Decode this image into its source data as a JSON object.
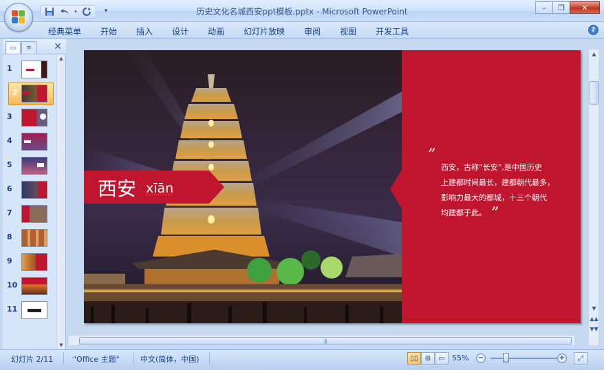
{
  "window": {
    "title": "历史文化名城西安ppt模板.pptx - Microsoft PowerPoint",
    "minimize_label": "–",
    "restore_label": "❐",
    "close_label": "✕"
  },
  "qat": {
    "save_icon": "save-icon",
    "undo_icon": "undo-icon",
    "redo_icon": "redo-icon",
    "customize_icon": "dropdown-arrow-icon"
  },
  "ribbon": {
    "tabs": [
      "经典菜单",
      "开始",
      "插入",
      "设计",
      "动画",
      "幻灯片放映",
      "审阅",
      "视图",
      "开发工具"
    ],
    "help_label": "?"
  },
  "left_panel": {
    "close_label": "✕",
    "slides": [
      {
        "num": "1"
      },
      {
        "num": "2"
      },
      {
        "num": "3"
      },
      {
        "num": "4"
      },
      {
        "num": "5"
      },
      {
        "num": "6"
      },
      {
        "num": "7"
      },
      {
        "num": "8"
      },
      {
        "num": "9"
      },
      {
        "num": "10"
      },
      {
        "num": "11"
      }
    ],
    "selected_index": 1
  },
  "slide": {
    "title_cn": "西安",
    "title_pinyin": "xīān",
    "open_quote": "”",
    "close_quote": "”",
    "description_lines": [
      "西安，古称“长安”,是中国历史",
      "上建都时间最长，建都朝代最多，",
      "影响力最大的都城，十三个朝代",
      "均建都于此。"
    ],
    "accent_color": "#c0152f"
  },
  "statusbar": {
    "slide_position": "幻灯片 2/11",
    "theme": "\"Office 主题\"",
    "language": "中文(简体，中国)",
    "zoom_level": "55%",
    "zoom_out_label": "−",
    "zoom_in_label": "+"
  }
}
